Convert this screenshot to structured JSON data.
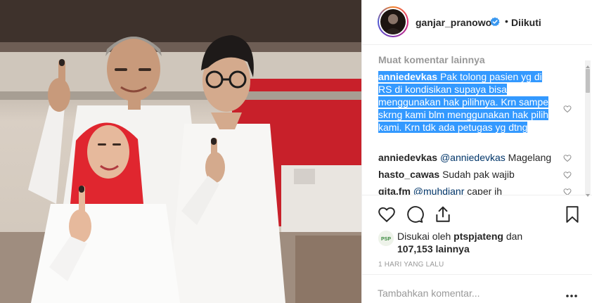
{
  "post": {
    "username": "ganjar_pranowo",
    "separator": "•",
    "follow_status": "Diikuti",
    "verified_icon": "verified-badge-icon",
    "colors": {
      "verified": "#3897f0",
      "selection": "#3399ff",
      "muted": "#999999"
    }
  },
  "comments": {
    "load_more": "Muat komentar lainnya",
    "items": [
      {
        "user": "anniedevkas",
        "text": "Pak tolong pasien yg di RS di kondisikan supaya bisa menggunakan hak pilihnya. Krn sampe skrng kami blm menggunakan hak pilih kami. Krn tdk ada petugas yg dtng"
      },
      {
        "user": "anniedevkas",
        "mention": "@anniedevkas",
        "text": "Magelang"
      },
      {
        "user": "hasto_cawas",
        "text": "Sudah pak wajib"
      },
      {
        "user": "gita.fm",
        "mention": "@muhdianr",
        "text": "caper ih"
      }
    ]
  },
  "actions": {
    "like": "heart-icon",
    "comment": "comment-icon",
    "share": "share-icon",
    "save": "bookmark-icon"
  },
  "likes": {
    "prefix": "Disukai oleh",
    "user": "ptspjateng",
    "connector": "dan",
    "count": "107,153",
    "suffix": "lainnya",
    "avatar_text": "PSP"
  },
  "timestamp": "1 HARI YANG LALU",
  "add_comment": {
    "placeholder": "Tambahkan komentar..."
  }
}
